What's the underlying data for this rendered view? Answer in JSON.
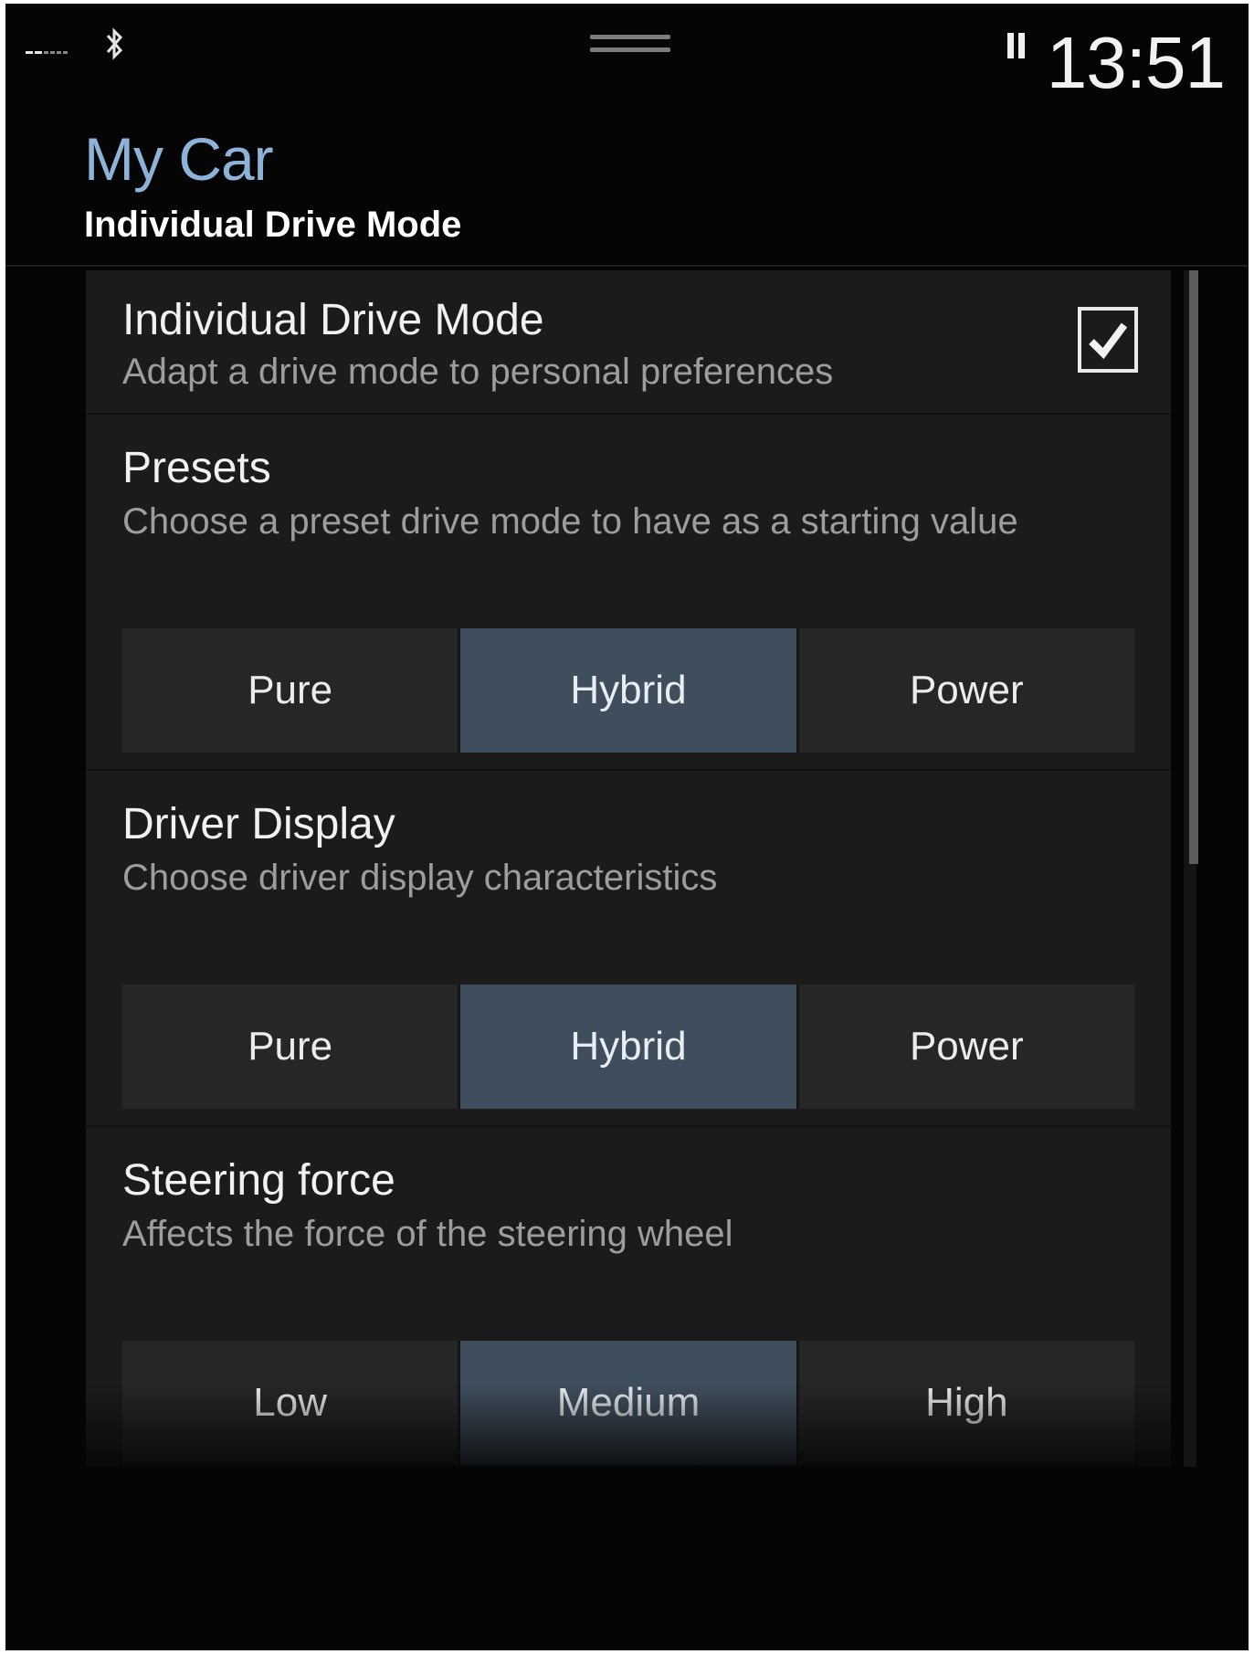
{
  "status": {
    "time": "13:51"
  },
  "header": {
    "title": "My Car",
    "subtitle": "Individual Drive Mode"
  },
  "settings": {
    "toggle": {
      "title": "Individual Drive Mode",
      "description": "Adapt a drive mode to personal preferences",
      "checked": true
    },
    "presets": {
      "title": "Presets",
      "description": "Choose a preset drive mode to have as a starting value",
      "options": [
        "Pure",
        "Hybrid",
        "Power"
      ],
      "selected": "Hybrid"
    },
    "driver_display": {
      "title": "Driver Display",
      "description": "Choose driver display characteristics",
      "options": [
        "Pure",
        "Hybrid",
        "Power"
      ],
      "selected": "Hybrid"
    },
    "steering_force": {
      "title": "Steering force",
      "description": "Affects the force of the steering wheel",
      "options": [
        "Low",
        "Medium",
        "High"
      ],
      "selected": "Medium"
    }
  },
  "colors": {
    "accent_title": "#8db3d8",
    "selected_segment": "#3f4e5d",
    "background": "#050505",
    "panel": "#1b1b1b"
  },
  "icons": [
    "signal-icon",
    "bluetooth-icon",
    "handle-icon",
    "pause-icon",
    "checkmark-icon"
  ]
}
